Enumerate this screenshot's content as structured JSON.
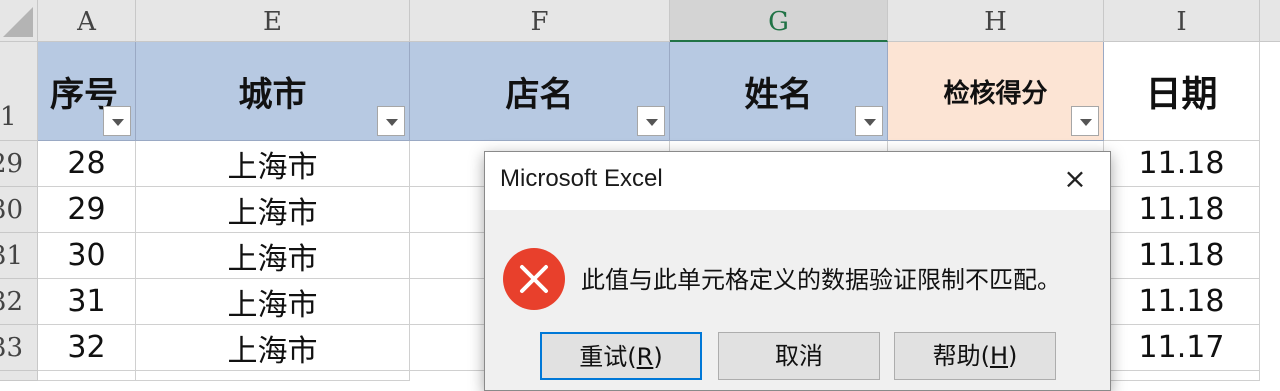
{
  "columns": [
    {
      "letter": "A"
    },
    {
      "letter": "E"
    },
    {
      "letter": "F"
    },
    {
      "letter": "G"
    },
    {
      "letter": "H"
    },
    {
      "letter": "I"
    }
  ],
  "header_row": {
    "row_number": "1",
    "labels": [
      "序号",
      "城市",
      "店名",
      "姓名",
      "检核得分",
      "日期"
    ]
  },
  "rows": [
    {
      "row_number": "29",
      "a": "28",
      "e": "上海市",
      "i": "11.18"
    },
    {
      "row_number": "30",
      "a": "29",
      "e": "上海市",
      "i": "11.18"
    },
    {
      "row_number": "31",
      "a": "30",
      "e": "上海市",
      "i": "11.18"
    },
    {
      "row_number": "32",
      "a": "31",
      "e": "上海市",
      "i": "11.18"
    },
    {
      "row_number": "33",
      "a": "32",
      "e": "上海市",
      "i": "11.17"
    }
  ],
  "dialog": {
    "title": "Microsoft Excel",
    "close_symbol": "×",
    "message": "此值与此单元格定义的数据验证限制不匹配。",
    "buttons": {
      "retry": {
        "text": "重试(",
        "key": "R",
        "suffix": ")"
      },
      "cancel": {
        "text": "取消"
      },
      "help": {
        "text": "帮助(",
        "key": "H",
        "suffix": ")"
      }
    }
  },
  "colors": {
    "header_blue": "#b7c9e2",
    "header_peach": "#fce4d4",
    "error_red": "#e8402c",
    "selected_column": "#217346"
  }
}
